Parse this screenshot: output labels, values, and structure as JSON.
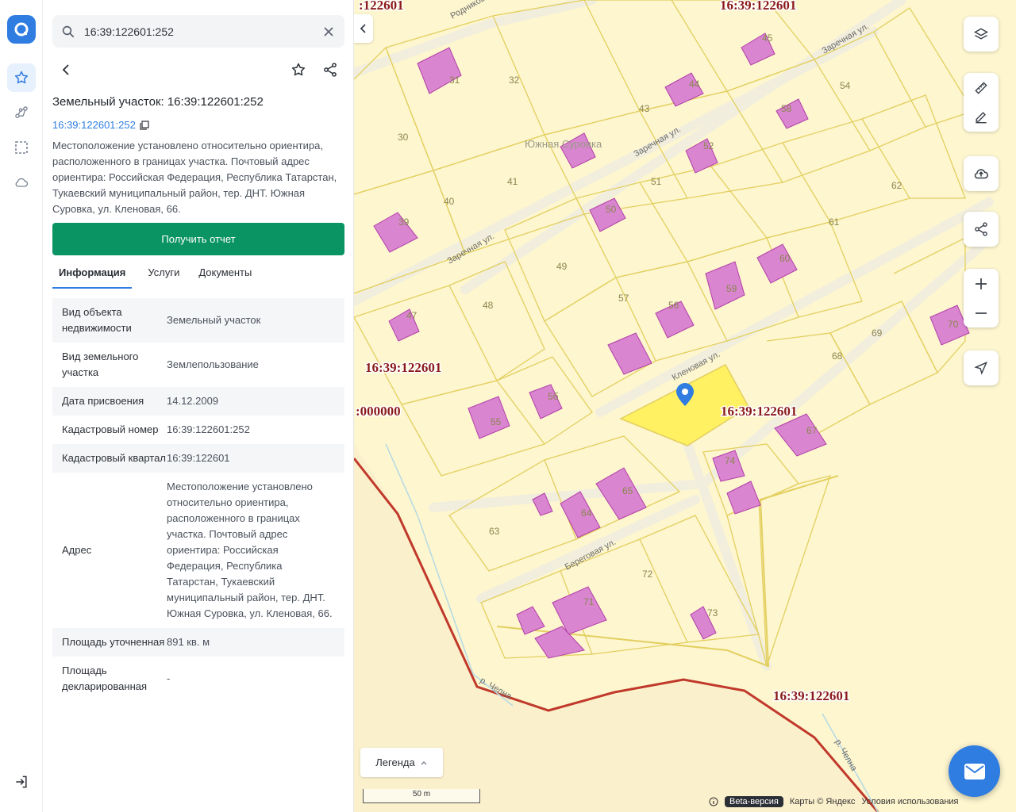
{
  "search": {
    "value": "16:39:122601:252"
  },
  "card": {
    "title": "Земельный участок: 16:39:122601:252",
    "cad_link": "16:39:122601:252",
    "description": "Местоположение установлено относительно ориентира, расположенного в границах участка. Почтовый адрес ориентира: Российская Федерация, Республика Татарстан, Тукаевский муниципальный район, тер. ДНТ. Южная Суровка, ул. Кленовая, 66.",
    "report_button": "Получить отчет"
  },
  "tabs": [
    {
      "label": "Информация",
      "active": true
    },
    {
      "label": "Услуги",
      "active": false
    },
    {
      "label": "Документы",
      "active": false
    }
  ],
  "info_rows": [
    {
      "key": "Вид объекта недвижимости",
      "value": "Земельный участок"
    },
    {
      "key": "Вид земельного участка",
      "value": "Землепользование"
    },
    {
      "key": "Дата присвоения",
      "value": "14.12.2009"
    },
    {
      "key": "Кадастровый номер",
      "value": "16:39:122601:252"
    },
    {
      "key": "Кадастровый квартал",
      "value": "16:39:122601"
    },
    {
      "key": "Адрес",
      "value": "Местоположение установлено относительно ориентира, расположенного в границах участка. Почтовый адрес ориентира: Российская Федерация, Республика Татарстан, Тукаевский муниципальный район, тер. ДНТ. Южная Суровка, ул. Кленовая, 66."
    },
    {
      "key": "Площадь уточненная",
      "value": "891 кв. м"
    },
    {
      "key": "Площадь декларированная",
      "value": "-"
    }
  ],
  "map": {
    "quarter_label": "16:39:122601",
    "zero_label": ":000000",
    "quarter_label_top": ":122601",
    "place_name": "Южная Суровка",
    "streets": {
      "zarechnaya": "Заречная ул.",
      "klenovaya": "Кленовая ул.",
      "beregovaya": "Береговая ул.",
      "rodnikovaya": "Родников"
    },
    "river": "р. Челна",
    "parcel_numbers": [
      "31",
      "32",
      "30",
      "40",
      "41",
      "39",
      "43",
      "44",
      "45",
      "54",
      "58",
      "52",
      "51",
      "50",
      "49",
      "48",
      "47",
      "57",
      "56",
      "59",
      "60",
      "61",
      "62",
      "69",
      "70",
      "68",
      "67",
      "74",
      "55",
      "5б",
      "65",
      "64",
      "63",
      "71",
      "72",
      "73"
    ],
    "legend": "Легенда",
    "scale": "50 m",
    "attribution": {
      "beta": "Beta-версия",
      "maps": "Карты © Яндекс",
      "terms": "Условия использования"
    }
  },
  "icons": {
    "logo": "logo-icon",
    "favorites": "star-icon",
    "routes": "nodes-icon",
    "selection": "select-area-icon",
    "cloud": "cloud-icon",
    "logout": "logout-icon",
    "search": "search-icon",
    "clear": "close-icon",
    "back": "back-icon",
    "star": "star-icon",
    "share": "share-icon",
    "copy": "copy-icon",
    "layers": "layers-icon",
    "ruler": "ruler-icon",
    "edit": "edit-icon",
    "upload": "upload-icon",
    "zoom_in": "plus-icon",
    "zoom_out": "minus-icon",
    "locate": "locate-icon",
    "mail": "mail-icon",
    "pin": "location-pin-icon"
  },
  "colors": {
    "accent": "#2f7de1",
    "report": "#0b9463",
    "parcel_line": "#e3cf5f",
    "building": "#d985d0",
    "boundary": "#c0392b",
    "quarter_text": "#8b1a1a",
    "selected": "#fff04d"
  }
}
